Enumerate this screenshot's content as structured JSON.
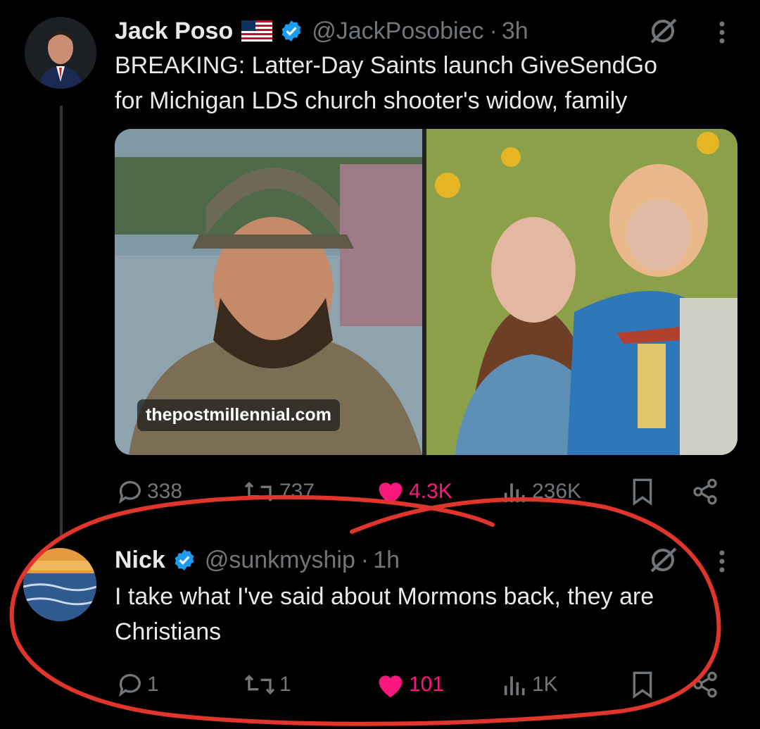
{
  "tweets": [
    {
      "name": "Jack Poso",
      "handle": "@JackPosobiec",
      "separator": "·",
      "time": "3h",
      "text_line1": "BREAKING: Latter-Day Saints launch GiveSendGo",
      "text_line2": "for Michigan LDS church shooter's widow, family",
      "media_watermark": "thepostmillennial.com",
      "actions": {
        "replies": "338",
        "reposts": "737",
        "likes": "4.3K",
        "views": "236K"
      }
    },
    {
      "name": "Nick",
      "handle": "@sunkmyship",
      "separator": "·",
      "time": "1h",
      "text_line1": "I take what I've said about Mormons back, they are",
      "text_line2": "Christians",
      "actions": {
        "replies": "1",
        "reposts": "1",
        "likes": "101",
        "views": "1K"
      }
    }
  ],
  "colors": {
    "background": "#000000",
    "text": "#e7e9ea",
    "muted": "#71767b",
    "like": "#f91880",
    "verified": "#1d9bf0",
    "annotation": "#e0352b"
  }
}
